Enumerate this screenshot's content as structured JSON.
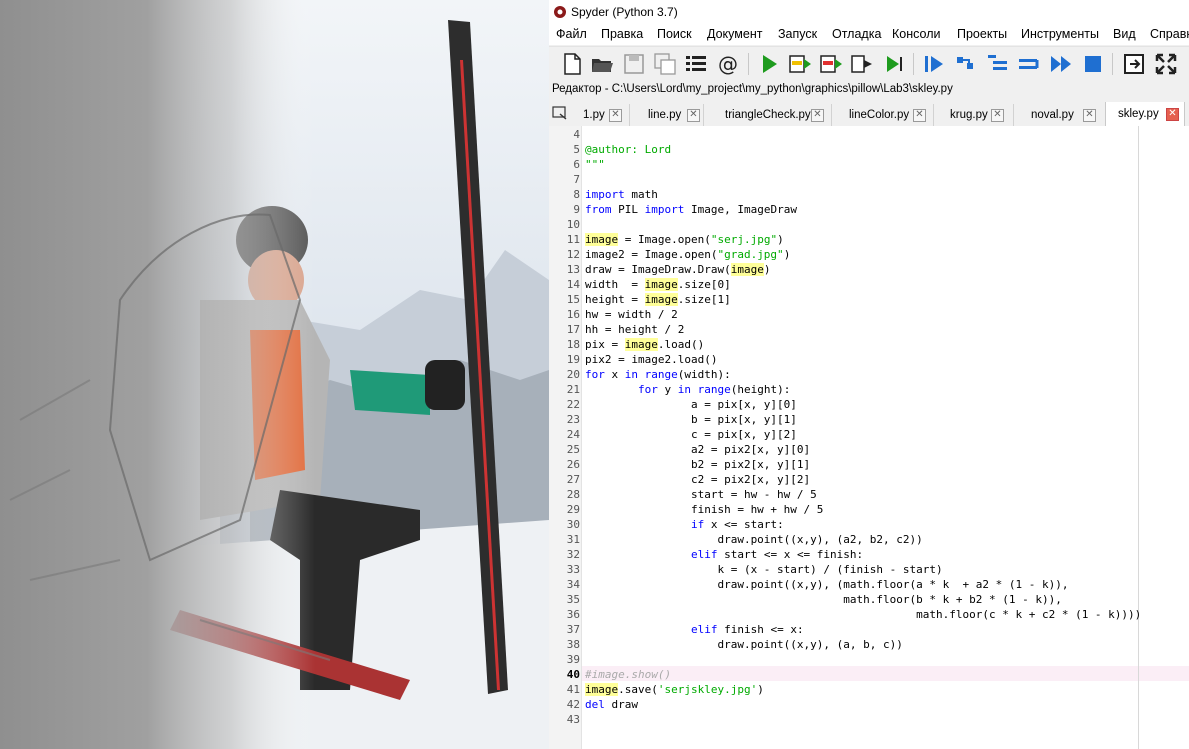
{
  "window": {
    "title": "Spyder (Python 3.7)"
  },
  "menu": [
    "Файл",
    "Правка",
    "Поиск",
    "Документ",
    "Запуск",
    "Отладка",
    "Консоли",
    "Проекты",
    "Инструменты",
    "Вид",
    "Справка"
  ],
  "toolbar": {
    "icons": [
      "new-file-icon",
      "open-file-icon",
      "save-icon",
      "save-all-icon",
      "outline-icon",
      "email-icon",
      "run-icon",
      "run-cell-icon",
      "run-cell-advance-icon",
      "run-selection-icon",
      "rerun-icon",
      "debug-icon",
      "step-icon",
      "step-into-icon",
      "step-return-icon",
      "continue-icon",
      "stop-debug-icon",
      "maximize-pane-icon",
      "fullscreen-icon"
    ]
  },
  "editor": {
    "path": "Редактор - C:\\Users\\Lord\\my_project\\my_python\\graphics\\pillow\\Lab3\\skley.py",
    "tabs": [
      "1.py",
      "line.py",
      "triangleCheck.py",
      "lineColor.py",
      "krug.py",
      "noval.py",
      "skley.py"
    ],
    "active_tab": "skley.py",
    "current_line": 40,
    "lines": [
      {
        "n": "4",
        "segs": []
      },
      {
        "n": "5",
        "segs": [
          {
            "t": "@author: Lord",
            "c": "str"
          }
        ]
      },
      {
        "n": "6",
        "segs": [
          {
            "t": "\"\"\"",
            "c": "str"
          }
        ]
      },
      {
        "n": "7",
        "segs": []
      },
      {
        "n": "8",
        "segs": [
          {
            "t": "import",
            "c": "kw"
          },
          {
            "t": " math"
          }
        ]
      },
      {
        "n": "9",
        "segs": [
          {
            "t": "from",
            "c": "kw"
          },
          {
            "t": " PIL "
          },
          {
            "t": "import",
            "c": "kw"
          },
          {
            "t": " Image, ImageDraw"
          }
        ]
      },
      {
        "n": "10",
        "segs": []
      },
      {
        "n": "11",
        "segs": [
          {
            "t": "image",
            "c": "hl"
          },
          {
            "t": " = Image.open("
          },
          {
            "t": "\"serj.jpg\"",
            "c": "str"
          },
          {
            "t": ")"
          }
        ]
      },
      {
        "n": "12",
        "segs": [
          {
            "t": "image2 = Image.open("
          },
          {
            "t": "\"grad.jpg\"",
            "c": "str"
          },
          {
            "t": ")"
          }
        ]
      },
      {
        "n": "13",
        "segs": [
          {
            "t": "draw = ImageDraw.Draw("
          },
          {
            "t": "image",
            "c": "hl"
          },
          {
            "t": ")"
          }
        ]
      },
      {
        "n": "14",
        "segs": [
          {
            "t": "width  = "
          },
          {
            "t": "image",
            "c": "hl"
          },
          {
            "t": ".size["
          },
          {
            "t": "0",
            "c": "num"
          },
          {
            "t": "]"
          }
        ]
      },
      {
        "n": "15",
        "segs": [
          {
            "t": "height = "
          },
          {
            "t": "image",
            "c": "hl"
          },
          {
            "t": ".size["
          },
          {
            "t": "1",
            "c": "num"
          },
          {
            "t": "]"
          }
        ]
      },
      {
        "n": "16",
        "segs": [
          {
            "t": "hw = width / 2"
          }
        ]
      },
      {
        "n": "17",
        "segs": [
          {
            "t": "hh = height / 2"
          }
        ]
      },
      {
        "n": "18",
        "segs": [
          {
            "t": "pix = "
          },
          {
            "t": "image",
            "c": "hl"
          },
          {
            "t": ".load()"
          }
        ]
      },
      {
        "n": "19",
        "segs": [
          {
            "t": "pix2 = image2.load()"
          }
        ]
      },
      {
        "n": "20",
        "segs": [
          {
            "t": "for",
            "c": "kw"
          },
          {
            "t": " x "
          },
          {
            "t": "in",
            "c": "kw"
          },
          {
            "t": " "
          },
          {
            "t": "range",
            "c": "kw"
          },
          {
            "t": "(width):"
          }
        ]
      },
      {
        "n": "21",
        "segs": [
          {
            "t": "        "
          },
          {
            "t": "for",
            "c": "kw"
          },
          {
            "t": " y "
          },
          {
            "t": "in",
            "c": "kw"
          },
          {
            "t": " "
          },
          {
            "t": "range",
            "c": "kw"
          },
          {
            "t": "(height):"
          }
        ]
      },
      {
        "n": "22",
        "segs": [
          {
            "t": "                a = pix[x, y][0]"
          }
        ]
      },
      {
        "n": "23",
        "segs": [
          {
            "t": "                b = pix[x, y][1]"
          }
        ]
      },
      {
        "n": "24",
        "segs": [
          {
            "t": "                c = pix[x, y][2]"
          }
        ]
      },
      {
        "n": "25",
        "segs": [
          {
            "t": "                a2 = pix2[x, y][0]"
          }
        ]
      },
      {
        "n": "26",
        "segs": [
          {
            "t": "                b2 = pix2[x, y][1]"
          }
        ]
      },
      {
        "n": "27",
        "segs": [
          {
            "t": "                c2 = pix2[x, y][2]"
          }
        ]
      },
      {
        "n": "28",
        "segs": [
          {
            "t": "                start = hw - hw / 5"
          }
        ]
      },
      {
        "n": "29",
        "segs": [
          {
            "t": "                finish = hw + hw / 5"
          }
        ]
      },
      {
        "n": "30",
        "segs": [
          {
            "t": "                "
          },
          {
            "t": "if",
            "c": "kw"
          },
          {
            "t": " x <= start:"
          }
        ]
      },
      {
        "n": "31",
        "segs": [
          {
            "t": "                    draw.point((x,y), (a2, b2, c2))"
          }
        ]
      },
      {
        "n": "32",
        "segs": [
          {
            "t": "                "
          },
          {
            "t": "elif",
            "c": "kw"
          },
          {
            "t": " start <= x <= finish:"
          }
        ]
      },
      {
        "n": "33",
        "segs": [
          {
            "t": "                    k = (x - start) / (finish - start)"
          }
        ]
      },
      {
        "n": "34",
        "segs": [
          {
            "t": "                    draw.point((x,y), (math.floor(a * k  + a2 * (1 - k)),"
          }
        ]
      },
      {
        "n": "35",
        "segs": [
          {
            "t": "                                       math.floor(b * k + b2 * (1 - k)),"
          }
        ]
      },
      {
        "n": "36",
        "segs": [
          {
            "t": "                                                  math.floor(c * k + c2 * (1 - k))))"
          }
        ]
      },
      {
        "n": "37",
        "segs": [
          {
            "t": "                "
          },
          {
            "t": "elif",
            "c": "kw"
          },
          {
            "t": " finish <= x:"
          }
        ]
      },
      {
        "n": "38",
        "segs": [
          {
            "t": "                    draw.point((x,y), (a, b, c))"
          }
        ]
      },
      {
        "n": "39",
        "segs": []
      },
      {
        "n": "40",
        "segs": [
          {
            "t": "#image.show()",
            "c": "com"
          }
        ]
      },
      {
        "n": "41",
        "segs": [
          {
            "t": "image",
            "c": "hl"
          },
          {
            "t": ".save("
          },
          {
            "t": "'serjskley.jpg'",
            "c": "str"
          },
          {
            "t": ")"
          }
        ]
      },
      {
        "n": "42",
        "segs": [
          {
            "t": "del",
            "c": "kw"
          },
          {
            "t": " draw"
          }
        ]
      },
      {
        "n": "43",
        "segs": []
      }
    ]
  }
}
